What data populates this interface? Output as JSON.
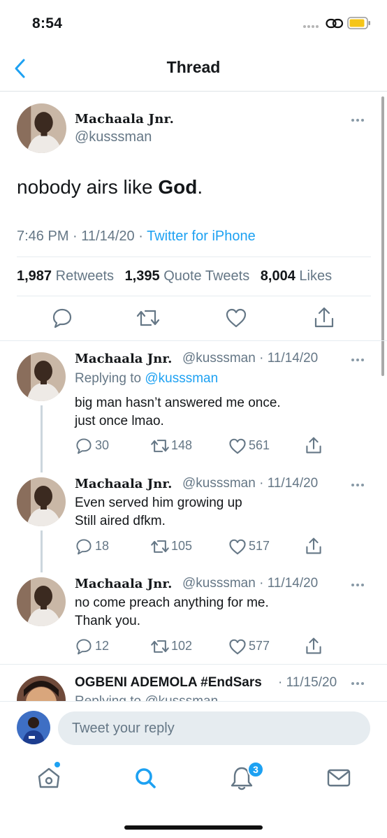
{
  "status_bar": {
    "time": "8:54"
  },
  "nav": {
    "title": "Thread"
  },
  "main_tweet": {
    "name": "Machaala Jnr.",
    "handle": "@kusssman",
    "text_prefix": "nobody airs like ",
    "text_bold": "God",
    "text_suffix": ".",
    "time": "7:46 PM",
    "date": "11/14/20",
    "sep": "·",
    "source": "Twitter for iPhone",
    "retweets_count": "1,987",
    "retweets_label": "Retweets",
    "quotes_count": "1,395",
    "quotes_label": "Quote Tweets",
    "likes_count": "8,004",
    "likes_label": "Likes"
  },
  "replies": [
    {
      "name": "Machaala Jnr.",
      "handle_date": "@kusssman · 11/14/20",
      "replying_prefix": "Replying to ",
      "replying_to": "@kusssman",
      "lines": [
        "big man hasn’t answered me once.",
        "just once lmao."
      ],
      "replies": "30",
      "retweets": "148",
      "likes": "561"
    },
    {
      "name": "Machaala Jnr.",
      "handle_date": "@kusssman · 11/14/20",
      "lines": [
        "Even served him growing up",
        "Still aired dfkm."
      ],
      "replies": "18",
      "retweets": "105",
      "likes": "517"
    },
    {
      "name": "Machaala Jnr.",
      "handle_date": "@kusssman · 11/14/20",
      "lines": [
        "no come preach anything for me.",
        "Thank you."
      ],
      "replies": "12",
      "retweets": "102",
      "likes": "577"
    },
    {
      "name": "OGBENI ADEMOLA #EndSars",
      "handle_date": "· 11/15/20",
      "replying_partial": "Replying to @kusssman"
    }
  ],
  "composer": {
    "placeholder": "Tweet your reply"
  },
  "tab_bar": {
    "notifications_badge": "3"
  },
  "colors": {
    "accent": "#1da1f2",
    "secondary_text": "#657786",
    "divider": "#e6ecf0"
  },
  "icons": [
    "chevron-left-icon",
    "more-icon",
    "reply-icon",
    "retweet-icon",
    "like-icon",
    "share-icon",
    "home-icon",
    "search-icon",
    "notifications-icon",
    "messages-icon"
  ]
}
